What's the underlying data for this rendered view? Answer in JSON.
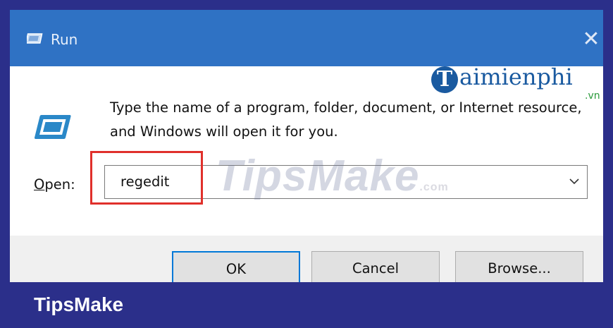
{
  "window": {
    "title": "Run",
    "close_glyph": "✕",
    "title_icon": "run-app-icon"
  },
  "dialog": {
    "description": "Type the name of a program, folder, document, or Internet resource, and Windows will open it for you.",
    "icon": "run-dialog-icon",
    "open_label_accel": "O",
    "open_label_rest": "pen:",
    "input_value": "regedit",
    "dropdown_icon": "chevron-down-icon"
  },
  "buttons": {
    "ok": "OK",
    "cancel": "Cancel",
    "browse": "Browse..."
  },
  "watermarks": {
    "tipsmake": "TipsMake",
    "tipsmake_suffix": ".com",
    "taimienphi_initial": "T",
    "taimienphi": "aimienphi",
    "taimienphi_tld": ".vn"
  },
  "banner": {
    "text": "TipsMake"
  },
  "colors": {
    "titlebar": "#2f72c4",
    "banner": "#2b2f8a",
    "highlight": "#e0302b",
    "ok_focus": "#0078d7"
  }
}
